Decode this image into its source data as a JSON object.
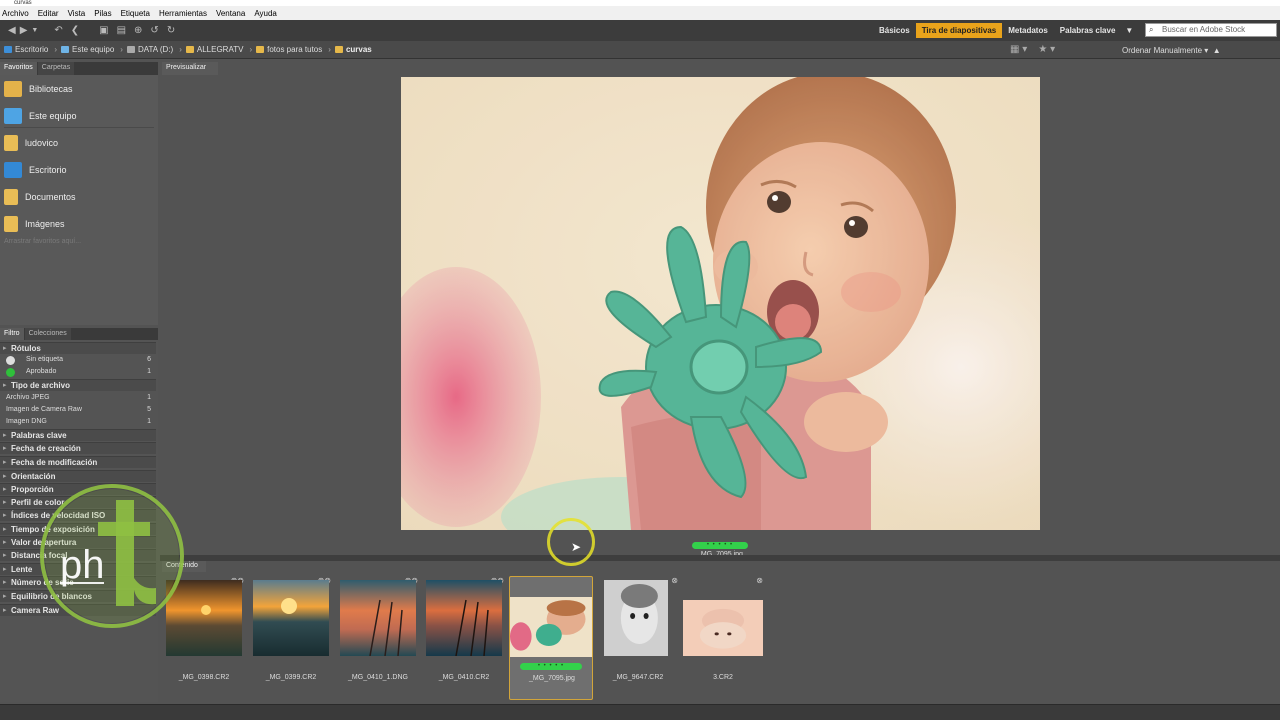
{
  "window": {
    "title": "curvas"
  },
  "menu": [
    "Archivo",
    "Editar",
    "Vista",
    "Pilas",
    "Etiqueta",
    "Herramientas",
    "Ventana",
    "Ayuda"
  ],
  "workspaces": [
    {
      "label": "Básicos",
      "active": false
    },
    {
      "label": "Tira de diapositivas",
      "active": true
    },
    {
      "label": "Metadatos",
      "active": false
    },
    {
      "label": "Palabras clave",
      "active": false
    }
  ],
  "stock_search": {
    "placeholder": "Buscar en Adobe Stock"
  },
  "breadcrumb": [
    "Escritorio",
    "Este equipo",
    "DATA (D:)",
    "ALLEGRATV",
    "fotos para tutos",
    "curvas"
  ],
  "sort_label": "Ordenar Manualmente",
  "left": {
    "fav_tabs": [
      "Favoritos",
      "Carpetas"
    ],
    "favorites": [
      "Bibliotecas",
      "Este equipo",
      "ludovico",
      "Escritorio",
      "Documentos",
      "Imágenes"
    ],
    "fav_hint": "Arrastrar favoritos aquí...",
    "filter_tabs": [
      "Filtro",
      "Colecciones"
    ],
    "filter": {
      "labels_head": "Rótulos",
      "labels": [
        {
          "label": "Sin etiqueta",
          "count": "6",
          "color": "#dddddd"
        },
        {
          "label": "Aprobado",
          "count": "1",
          "color": "#2fbf3b"
        }
      ],
      "filetype_head": "Tipo de archivo",
      "filetypes": [
        {
          "label": "Archivo JPEG",
          "count": "1"
        },
        {
          "label": "Imagen de Camera Raw",
          "count": "5"
        },
        {
          "label": "Imagen DNG",
          "count": "1"
        }
      ],
      "sections": [
        "Palabras clave",
        "Fecha de creación",
        "Fecha de modificación",
        "Orientación",
        "Proporción",
        "Perfil de color",
        "Índices de velocidad ISO",
        "Tiempo de exposición",
        "Valor de apertura",
        "Distancia focal",
        "Lente",
        "Número de serie",
        "Equilibrio de blancos",
        "Camera Raw"
      ]
    }
  },
  "preview": {
    "tab": "Previsualizar",
    "filename": "_MG_7095.jpg",
    "rating": "• • • • •"
  },
  "content": {
    "tab": "Contenido",
    "items": [
      {
        "name": "_MG_0398.CR2",
        "icon": "sunset-photo"
      },
      {
        "name": "_MG_0399.CR2",
        "icon": "sunset-photo"
      },
      {
        "name": "_MG_0410_1.DNG",
        "icon": "sunset-photo"
      },
      {
        "name": "_MG_0410.CR2",
        "icon": "sunset-photo"
      },
      {
        "name": "_MG_7095.jpg",
        "icon": "baby-photo",
        "rating": "• • • • •"
      },
      {
        "name": "_MG_9647.CR2",
        "icon": "baby-bw-photo"
      },
      {
        "name": "3.CR2",
        "icon": "baby-photo"
      }
    ]
  },
  "colors": {
    "accent": "#e9a31b",
    "approved": "#33d14b",
    "logo": "#8fc043"
  }
}
